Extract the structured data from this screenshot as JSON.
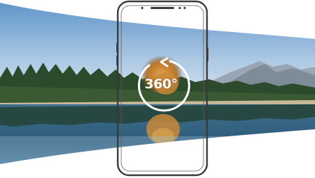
{
  "badge": {
    "label": "360°"
  },
  "colors": {
    "sky_top": "#5c93c8",
    "sky_bottom": "#dfeaf3",
    "water": "#2d5b7a",
    "forest": "#2c4a2c",
    "phone_frame": "#3a3a3a",
    "badge": "#ffffff"
  },
  "icons": [
    "phone-frame",
    "rotate-arrow-icon",
    "panorama-image"
  ]
}
